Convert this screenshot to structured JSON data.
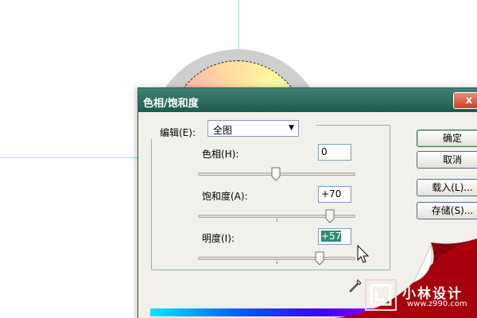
{
  "dialog": {
    "title": "色相/饱和度",
    "close_label": "x",
    "edit_label": "编辑(E):",
    "edit_value": "全图",
    "fields": [
      {
        "label": "色相(H):",
        "value": "0",
        "slider_fraction": 0.5
      },
      {
        "label": "饱和度(A):",
        "value": "+70",
        "slider_fraction": 0.85
      },
      {
        "label": "明度(I):",
        "value": "+57",
        "slider_fraction": 0.785
      }
    ],
    "buttons": {
      "ok": "确定",
      "cancel": "取消",
      "load": "载入(L)...",
      "save": "存储(S)..."
    }
  },
  "brand": {
    "name": "小林设计",
    "url": "www.z990.com"
  },
  "colors": {
    "title_bar": "#1d5c4f",
    "selection": "#2d8d72",
    "curl_red": "#a8000a"
  }
}
